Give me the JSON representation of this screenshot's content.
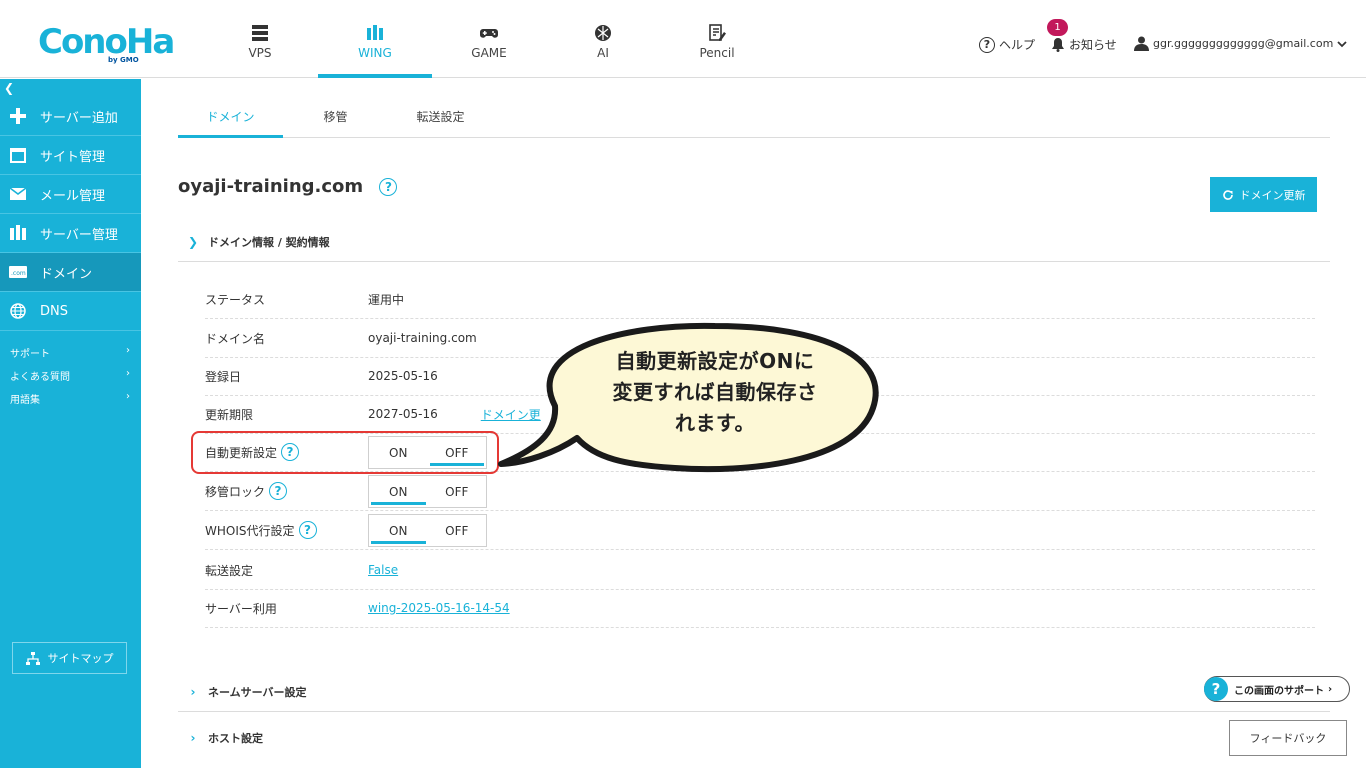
{
  "brand": {
    "logo": "ConoHa",
    "logo_sub": "by GMO"
  },
  "header": {
    "tabs": [
      {
        "label": "VPS",
        "icon": "server-icon"
      },
      {
        "label": "WING",
        "icon": "wing-icon"
      },
      {
        "label": "GAME",
        "icon": "gamepad-icon"
      },
      {
        "label": "AI",
        "icon": "ai-icon"
      },
      {
        "label": "Pencil",
        "icon": "pencil-icon"
      }
    ],
    "help": "ヘルプ",
    "notifications": "お知らせ",
    "notification_count": "1",
    "user_email": "ggr.ggggggggggggg@gmail.com"
  },
  "sidebar": {
    "items": [
      {
        "label": "サーバー追加",
        "icon": "plus-icon"
      },
      {
        "label": "サイト管理",
        "icon": "window-icon"
      },
      {
        "label": "メール管理",
        "icon": "mail-icon"
      },
      {
        "label": "サーバー管理",
        "icon": "server-manage-icon"
      },
      {
        "label": "ドメイン",
        "icon": "domain-icon"
      },
      {
        "label": "DNS",
        "icon": "globe-icon"
      }
    ],
    "links": [
      "サポート",
      "よくある質問",
      "用語集"
    ],
    "sitemap": "サイトマップ"
  },
  "subtabs": [
    "ドメイン",
    "移管",
    "転送設定"
  ],
  "domain": {
    "title": "oyaji-training.com",
    "renew_button": "ドメイン更新",
    "section_info": "ドメイン情報 / 契約情報",
    "rows": {
      "status_k": "ステータス",
      "status_v": "運用中",
      "name_k": "ドメイン名",
      "name_v": "oyaji-training.com",
      "reg_k": "登録日",
      "reg_v": "2025-05-16",
      "exp_k": "更新期限",
      "exp_v": "2027-05-16",
      "exp_link": "ドメイン更",
      "auto_k": "自動更新設定",
      "lock_k": "移管ロック",
      "whois_k": "WHOIS代行設定",
      "fwd_k": "転送設定",
      "fwd_v": "False",
      "server_k": "サーバー利用",
      "server_v": "wing-2025-05-16-14-54"
    },
    "toggle_on": "ON",
    "toggle_off": "OFF",
    "section_ns": "ネームサーバー設定",
    "section_host": "ホスト設定"
  },
  "callout": {
    "line1": "自動更新設定がONに",
    "line2": "変更すれば自動保存さ",
    "line3": "れます。"
  },
  "support": "この画面のサポート",
  "feedback": "フィードバック",
  "colors": {
    "accent": "#19b2d8",
    "highlight": "#e53935",
    "callout_bg": "#fdf8d6",
    "badge": "#c2185b"
  }
}
